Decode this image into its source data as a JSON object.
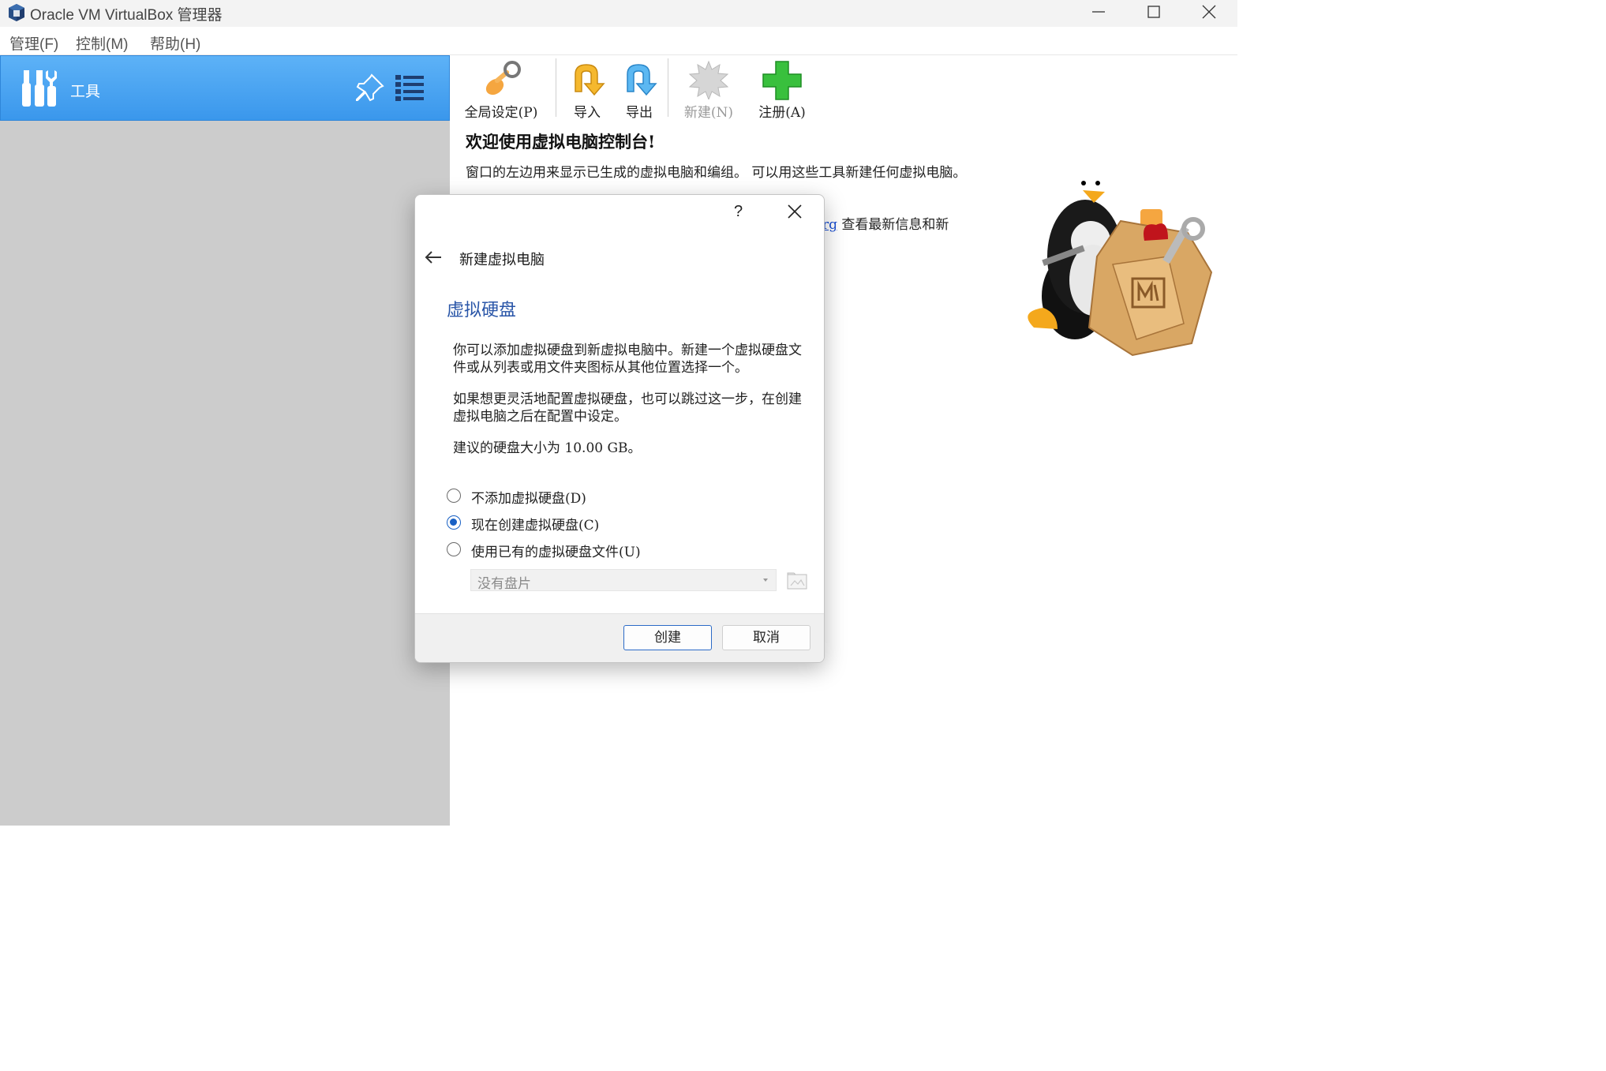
{
  "window": {
    "title": "Oracle VM VirtualBox 管理器"
  },
  "menubar": {
    "items": [
      "管理(F)",
      "控制(M)",
      "帮助(H)"
    ]
  },
  "sidebar": {
    "tools_label": "工具"
  },
  "toolbar": {
    "buttons": [
      {
        "label": "全局设定(P)",
        "icon": "global-settings-icon",
        "enabled": true
      },
      {
        "label": "导入",
        "icon": "import-icon",
        "enabled": true
      },
      {
        "label": "导出",
        "icon": "export-icon",
        "enabled": true
      },
      {
        "label": "新建(N)",
        "icon": "new-vm-icon",
        "enabled": false
      },
      {
        "label": "注册(A)",
        "icon": "register-icon",
        "enabled": true
      }
    ]
  },
  "welcome": {
    "title": "欢迎使用虚拟电脑控制台!",
    "text": "窗口的左边用来显示已生成的虚拟电脑和编组。 可以用这些工具新建任何虚拟电脑。",
    "link_fragment": "rg",
    "text_after_link": "查看最新信息和新"
  },
  "dialog": {
    "help": "?",
    "title": "新建虚拟电脑",
    "heading": "虚拟硬盘",
    "para1": "你可以添加虚拟硬盘到新虚拟电脑中。新建一个虚拟硬盘文件或从列表或用文件夹图标从其他位置选择一个。",
    "para2": "如果想更灵活地配置虚拟硬盘，也可以跳过这一步，在创建虚拟电脑之后在配置中设定。",
    "para3": "建议的硬盘大小为 10.00 GB。",
    "options": [
      {
        "label": "不添加虚拟硬盘(D)",
        "checked": false
      },
      {
        "label": "现在创建虚拟硬盘(C)",
        "checked": true
      },
      {
        "label": "使用已有的虚拟硬盘文件(U)",
        "checked": false
      }
    ],
    "disk_select_value": "没有盘片",
    "create_button": "创建",
    "cancel_button": "取消"
  },
  "colors": {
    "accent": "#3a97ec",
    "sidebar_bg": "#cccccc",
    "heading": "#2a56a8",
    "radio_checked": "#1860c4"
  }
}
